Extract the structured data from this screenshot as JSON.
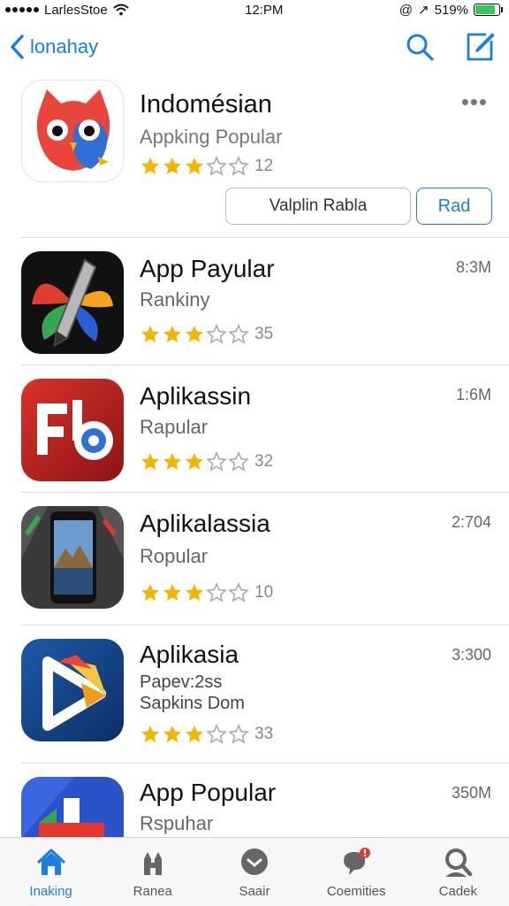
{
  "status_bar": {
    "carrier": "LarlesStoe",
    "time": "12:PM",
    "battery": "519%"
  },
  "nav": {
    "back_label": "lonahay",
    "icons": [
      "search-icon",
      "compose-icon"
    ]
  },
  "featured": {
    "title": "Indomésian",
    "subtitle": "Appking Popular",
    "rating": 3.5,
    "rating_count": "12",
    "more_label": "•••",
    "secondary_button": "Valplin Rabla",
    "primary_button": "Rad"
  },
  "apps": [
    {
      "title": "App Payular",
      "subtitle": "Rankiny",
      "rating": 3.5,
      "rating_count": "35",
      "size": "8:3M"
    },
    {
      "title": "Aplikassin",
      "subtitle": "Rapular",
      "rating": 3.5,
      "rating_count": "32",
      "size": "1:6M"
    },
    {
      "title": "Aplikalassia",
      "subtitle": "Ropular",
      "rating": 3.5,
      "rating_count": "10",
      "size": "2:704"
    },
    {
      "title": "Aplikasia",
      "subtitle": "Papev:2ss",
      "subtitle2": "Sapkins Dom",
      "rating": 3.5,
      "rating_count": "33",
      "size": "3:300"
    },
    {
      "title": "App Popular",
      "subtitle": "Rspuhar",
      "size": "350M"
    }
  ],
  "tabs": [
    {
      "label": "Inaking",
      "icon": "house-icon",
      "active": true
    },
    {
      "label": "Ranea",
      "icon": "castle-icon",
      "active": false
    },
    {
      "label": "Saair",
      "icon": "chat-bubble-icon",
      "active": false
    },
    {
      "label": "Coemities",
      "icon": "notification-bubble-icon",
      "active": false
    },
    {
      "label": "Cadek",
      "icon": "search-person-icon",
      "active": false
    }
  ],
  "colors": {
    "accent": "#1a7fe0",
    "star": "#f4b400"
  }
}
